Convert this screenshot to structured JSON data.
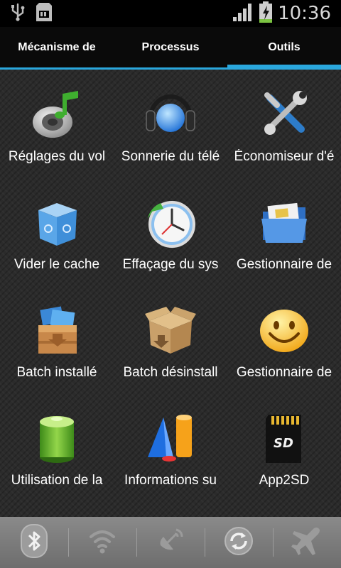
{
  "status_bar": {
    "time": "10:36",
    "icons": [
      "usb-icon",
      "sd-card-icon",
      "signal-icon",
      "battery-charging-icon"
    ]
  },
  "tabs": [
    {
      "label": "Mécanisme de",
      "active": false
    },
    {
      "label": "Processus",
      "active": false
    },
    {
      "label": "Outils",
      "active": true
    }
  ],
  "tools": [
    {
      "label": "Réglages du vol",
      "icon": "volume-settings-icon"
    },
    {
      "label": "Sonnerie du télé",
      "icon": "ringtone-headphones-icon"
    },
    {
      "label": "Économiseur d'é",
      "icon": "tools-icon"
    },
    {
      "label": "Vider le cache",
      "icon": "recycle-bin-icon"
    },
    {
      "label": "Effaçage du sys",
      "icon": "clock-icon"
    },
    {
      "label": "Gestionnaire de",
      "icon": "folder-icon"
    },
    {
      "label": "Batch installé",
      "icon": "batch-install-icon"
    },
    {
      "label": "Batch désinstall",
      "icon": "box-uninstall-icon"
    },
    {
      "label": "Gestionnaire de",
      "icon": "smiley-icon"
    },
    {
      "label": "Utilisation de la",
      "icon": "battery-icon"
    },
    {
      "label": "Informations su",
      "icon": "shapes-icon"
    },
    {
      "label": "App2SD",
      "icon": "sd-card-icon"
    }
  ],
  "toggles": [
    "bluetooth-icon",
    "wifi-icon",
    "gps-icon",
    "sync-icon",
    "airplane-icon"
  ],
  "colors": {
    "accent": "#2aa7dd",
    "background": "#2b2b2b",
    "toggle_bar": "#7a7a7a"
  }
}
